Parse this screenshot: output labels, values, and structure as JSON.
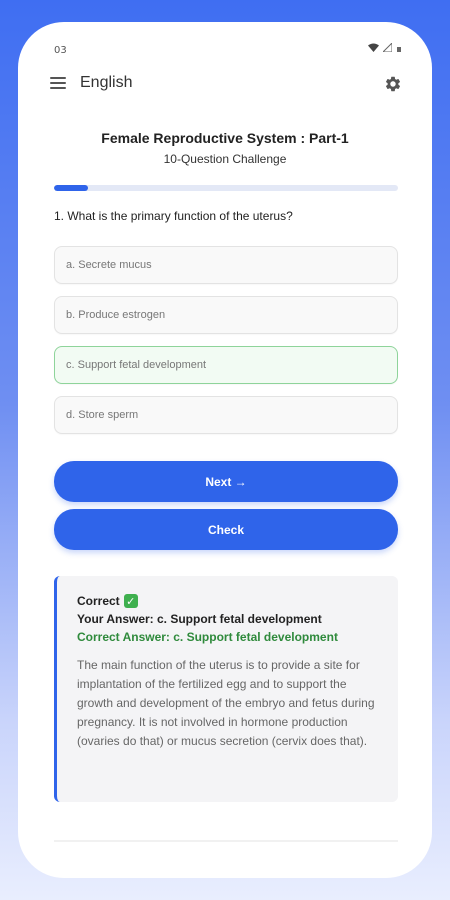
{
  "status_bar": {
    "time": "03"
  },
  "app_bar": {
    "language": "English"
  },
  "quiz": {
    "title": "Female Reproductive System : Part-1",
    "subtitle": "10-Question Challenge",
    "progress": 0.1
  },
  "question": {
    "text": "1. What is the primary function of the uterus?"
  },
  "options": [
    {
      "label": "a. Secrete mucus"
    },
    {
      "label": "b. Produce estrogen"
    },
    {
      "label": "c. Support fetal development"
    },
    {
      "label": "d. Store sperm"
    }
  ],
  "buttons": {
    "next": "Next →",
    "check": "Check"
  },
  "feedback": {
    "status": "Correct",
    "your_answer": "Your Answer: c. Support fetal development",
    "correct_answer": "Correct Answer: c. Support fetal development",
    "explanation": "The main function of the uterus is to provide a site for implantation of the fertilized egg and to support the growth and development of the embryo and fetus during pregnancy. It is not involved in hormone production (ovaries do that) or mucus secretion (cervix does that)."
  },
  "colors": {
    "accent": "#2f64ea",
    "correct": "#2f8a3c",
    "correct_border": "#8ed49a"
  }
}
